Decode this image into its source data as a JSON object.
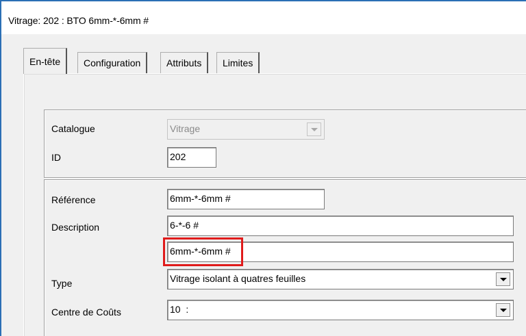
{
  "window": {
    "title": "Vitrage: 202 : BTO 6mm-*-6mm #"
  },
  "tabs": [
    {
      "label": "En-tête",
      "active": true
    },
    {
      "label": "Configuration",
      "active": false
    },
    {
      "label": "Attributs",
      "active": false
    },
    {
      "label": "Limites",
      "active": false
    }
  ],
  "header_group": {
    "catalogue_label": "Catalogue",
    "catalogue_value": "Vitrage",
    "id_label": "ID",
    "id_value": "202"
  },
  "details_group": {
    "reference_label": "Référence",
    "reference_value": "6mm-*-6mm #",
    "description_label": "Description",
    "description_value": "6-*-6 #",
    "description_long_value": "6mm-*-6mm #",
    "type_label": "Type",
    "type_value": "Vitrage isolant à quatres feuilles",
    "cost_center_label": "Centre de Coûts",
    "cost_center_value": "10  :"
  },
  "colors": {
    "highlight": "#e01b1b",
    "window_border": "#2b6fb5"
  }
}
